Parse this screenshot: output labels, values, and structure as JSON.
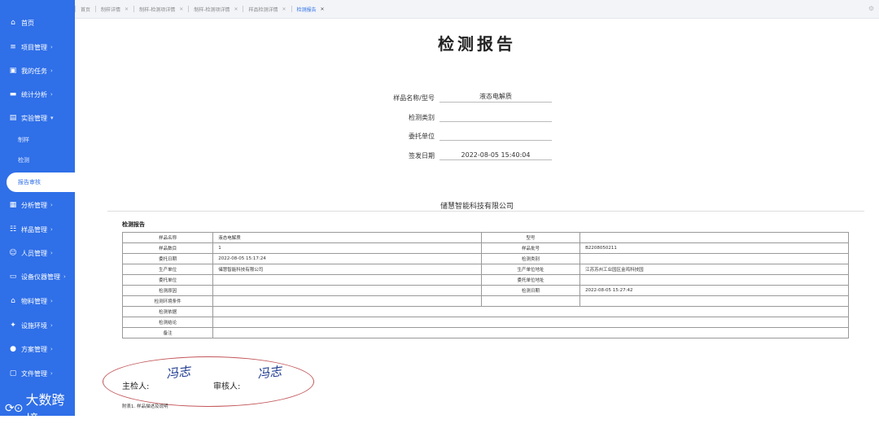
{
  "sidebar": {
    "items": [
      {
        "label": "首页",
        "icon": "home-icon",
        "arrow": false
      },
      {
        "label": "项目管理",
        "icon": "list-icon",
        "arrow": true
      },
      {
        "label": "我的任务",
        "icon": "task-icon",
        "arrow": true
      },
      {
        "label": "统计分析",
        "icon": "chart-icon",
        "arrow": true
      },
      {
        "label": "实验管理",
        "icon": "document-icon",
        "arrow": true
      },
      {
        "label": "分析管理",
        "icon": "grid-icon",
        "arrow": true
      },
      {
        "label": "样品管理",
        "icon": "sample-icon",
        "arrow": true
      },
      {
        "label": "人员管理",
        "icon": "user-icon",
        "arrow": true
      },
      {
        "label": "设备仪器管理",
        "icon": "device-icon",
        "arrow": true
      },
      {
        "label": "物料管理",
        "icon": "material-icon",
        "arrow": true
      },
      {
        "label": "设施环境",
        "icon": "facility-icon",
        "arrow": true
      },
      {
        "label": "方案管理",
        "icon": "bulb-icon",
        "arrow": true
      },
      {
        "label": "文件管理",
        "icon": "folder-icon",
        "arrow": true
      }
    ],
    "sub_items": [
      "制样",
      "检测",
      "报告审核"
    ],
    "watermark": "大数跨境"
  },
  "tabs": [
    "首页",
    "制样详情",
    "制样-检测项详情",
    "制样-检测项详情",
    "样品检测详情",
    "检测报告"
  ],
  "report": {
    "title": "检测报告",
    "fields": [
      {
        "label": "样品名称/型号",
        "value": "液态电解质"
      },
      {
        "label": "检测类别",
        "value": ""
      },
      {
        "label": "委托单位",
        "value": ""
      },
      {
        "label": "签发日期",
        "value": "2022-08-05 15:40:04"
      }
    ],
    "company": "储慧智能科技有限公司",
    "table_label": "检测报告",
    "rows": [
      [
        "样品名称",
        "液态电解质",
        "型号",
        ""
      ],
      [
        "样品数目",
        "1",
        "样品批号",
        "B2208050211"
      ],
      [
        "委托日期",
        "2022-08-05 15:17:24",
        "检测类别",
        ""
      ],
      [
        "生产单位",
        "储慧智能科技有限公司",
        "生产单位地址",
        "江苏苏州工业园区金鸡科技园"
      ],
      [
        "委托单位",
        "",
        "委托单位地址",
        ""
      ],
      [
        "检测原因",
        "",
        "检测日期",
        "2022-08-05 15:27:42"
      ],
      [
        "检测环境条件",
        "",
        "",
        ""
      ]
    ],
    "full_rows": [
      [
        "检测依据",
        ""
      ],
      [
        "检测结论",
        ""
      ],
      [
        "备注",
        ""
      ]
    ],
    "inspector_label": "主检人:",
    "reviewer_label": "审核人:",
    "inspector_sig": "冯志",
    "reviewer_sig": "冯志",
    "attachment": "附表1. 样品描述及说明"
  }
}
